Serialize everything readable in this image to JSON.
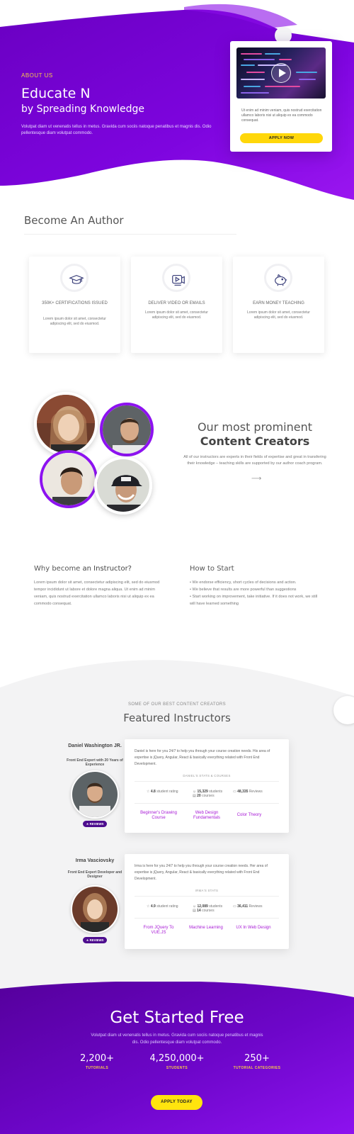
{
  "hero": {
    "kicker": "ABOUT US",
    "title": "Educate N",
    "subtitle": "by Spreading Knowledge",
    "description": "Volutpat diam ut venenatis tellus in metus. Gravida cum sociis natoque penatibus et magnis dis. Odio pellentesque diam volutpat commodo.",
    "video_card": {
      "text": "Ut enim ad minim veniam, quis nostrud exercitation ullamco laboris nisi ut aliquip ex ea commodo consequat.",
      "button": "APPLY NOW"
    },
    "colors": {
      "primary": "#7c05d9",
      "accent": "#ffd70a"
    }
  },
  "author": {
    "title": "Become An Author",
    "features": [
      {
        "icon": "graduation-cap-icon",
        "title": "350K+ CERTIFICATIONS ISSUED",
        "desc": "Lorem ipsum dolor sit amet, consectetur adipiscing elit, sed do eiusmod."
      },
      {
        "icon": "video-camera-icon",
        "title": "DELIVER VIDEO OR EMAILS",
        "desc": "Lorem ipsum dolor sit amet, consectetur adipiscing elit, sed do eiusmod."
      },
      {
        "icon": "piggy-bank-icon",
        "title": "EARN MONEY TEACHING",
        "desc": "Lorem ipsum dolor sit amet, consectetur adipiscing elit, sed do eiusmod."
      }
    ]
  },
  "creators": {
    "title_line1": "Our most prominent",
    "title_line2": "Content Creators",
    "description": "All of our instructors are experts in their fields of expertise and great in transfering their knowledge – teaching skills are supported by our author coach program.",
    "arrow": "⟶"
  },
  "why": {
    "title_prefix": "Why become ",
    "title_bold": "an Instructor?",
    "text": "Lorem ipsum dolor sit amet, consectetur adipiscing elit, sed do eiusmod tempor incididunt ut labore et dolore magna aliqua. Ut enim ad minim veniam, quis nostrud exercitation ullamco laboris nisi ut aliquip ex ea commodo consequat."
  },
  "how": {
    "title": "How to Start",
    "items": [
      "• We endorse efficiency, short cycles of decisions and action.",
      "• We believe that results are more powerful than suggestions",
      "• Start working on improvement, take initiative. If it does not work, we still will have learned something"
    ]
  },
  "instructors": {
    "kicker": "SOME OF OUR BEST CONTENT CREATORS",
    "title": "Featured Instructors",
    "list": [
      {
        "name": "Daniel Washington JR.",
        "role": "Front End Expert with 20 Years of Experience",
        "badge": "REVIEWS",
        "bio": "Daniel is here for you 24/7 to help you through your course creation needs. His area of expertise is jQuery, Angular, React & basically everything related with Front End Development.",
        "stats_title": "DANIEL'S STATS & COURSES",
        "rating": "4.8",
        "rating_label": "student rating",
        "students": "15,329",
        "students_label": "students",
        "courses": "20",
        "courses_label": "courses",
        "reviews": "48,335",
        "reviews_label": "Reviews",
        "course_links": [
          "Beginner's Drawing Course",
          "Web Design Fundamentals",
          "Color Theory"
        ]
      },
      {
        "name": "Irma Vasciovsky",
        "role": "Front End Expert Developer and Designer",
        "badge": "REVIEWS",
        "bio": "Irma is here for you 24/7 to help you through your course creation needs. Her area of expertise is jQuery, Angular, React & basically everything related with Front End Development.",
        "stats_title": "IRMA'S STATS",
        "rating": "4.9",
        "rating_label": "student rating",
        "students": "12,089",
        "students_label": "students",
        "courses": "14",
        "courses_label": "courses",
        "reviews": "36,411",
        "reviews_label": "Reviews",
        "course_links": [
          "From JQuery To VUE.JS",
          "Machine Learning",
          "UX In Web Design"
        ]
      }
    ]
  },
  "cta": {
    "title": "Get Started Free",
    "description": "Volutpat diam ut venenatis tellus in metus. Gravida cum sociis natoque penatibus et magnis dis. Odio pellentesque diam volutpat commodo.",
    "stats": [
      {
        "value": "2,200+",
        "label": "TUTORIALS"
      },
      {
        "value": "4,250,000+",
        "label": "STUDENTS"
      },
      {
        "value": "250+",
        "label": "TUTORIAL CATEGORIES"
      }
    ],
    "button": "APPLY TODAY"
  }
}
